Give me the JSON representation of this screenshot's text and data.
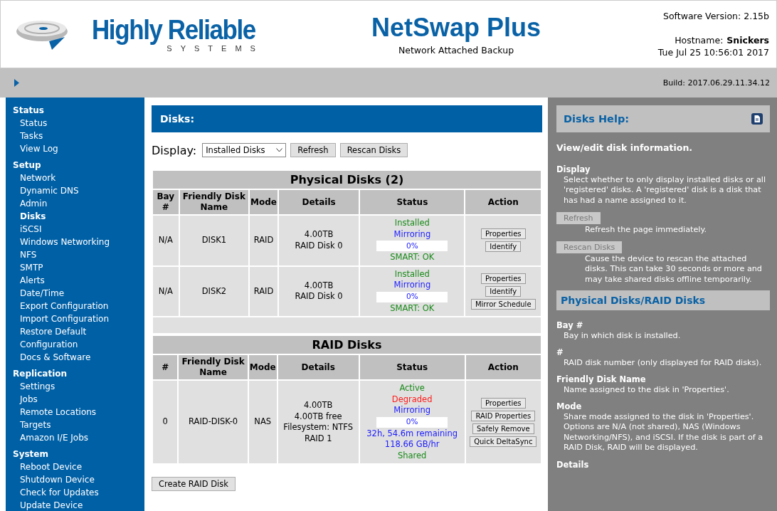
{
  "header": {
    "logo": {
      "name": "Highly Reliable",
      "tagline": "SYSTEMS"
    },
    "title": "NetSwap Plus",
    "subtitle": "Network Attached Backup",
    "software_version": "Software Version: 2.15b",
    "hostname_label": "Hostname:",
    "hostname": "Snickers",
    "datetime": "Tue Jul 25 10:56:01 2017"
  },
  "toolbar": {
    "build": "Build: 2017.06.29.11.34.12"
  },
  "sidebar": {
    "sections": [
      {
        "title": "Status",
        "items": [
          {
            "label": "Status",
            "selected": false
          },
          {
            "label": "Tasks",
            "selected": false
          },
          {
            "label": "View Log",
            "selected": false
          }
        ]
      },
      {
        "title": "Setup",
        "items": [
          {
            "label": "Network",
            "selected": false
          },
          {
            "label": "Dynamic DNS",
            "selected": false
          },
          {
            "label": "Admin",
            "selected": false
          },
          {
            "label": "Disks",
            "selected": true
          },
          {
            "label": "iSCSI",
            "selected": false
          },
          {
            "label": "Windows Networking",
            "selected": false
          },
          {
            "label": "NFS",
            "selected": false
          },
          {
            "label": "SMTP",
            "selected": false
          },
          {
            "label": "Alerts",
            "selected": false
          },
          {
            "label": "Date/Time",
            "selected": false
          },
          {
            "label": "Export Configuration",
            "selected": false
          },
          {
            "label": "Import Configuration",
            "selected": false
          },
          {
            "label": "Restore Default Configuration",
            "selected": false
          },
          {
            "label": "Docs & Software",
            "selected": false
          }
        ]
      },
      {
        "title": "Replication",
        "items": [
          {
            "label": "Settings",
            "selected": false
          },
          {
            "label": "Jobs",
            "selected": false
          },
          {
            "label": "Remote Locations",
            "selected": false
          },
          {
            "label": "Targets",
            "selected": false
          },
          {
            "label": "Amazon I/E Jobs",
            "selected": false
          }
        ]
      },
      {
        "title": "System",
        "items": [
          {
            "label": "Reboot Device",
            "selected": false
          },
          {
            "label": "Shutdown Device",
            "selected": false
          },
          {
            "label": "Check for Updates",
            "selected": false
          },
          {
            "label": "Update Device",
            "selected": false
          }
        ]
      }
    ]
  },
  "main": {
    "title": "Disks:",
    "display_label": "Display:",
    "display_select": "Installed Disks",
    "buttons": [
      "Refresh",
      "Rescan Disks"
    ],
    "tables": [
      {
        "title": "Physical Disks (2)",
        "columns": [
          "Bay #",
          "Friendly Disk Name",
          "Mode",
          "Details",
          "Status",
          "Action"
        ],
        "rows": [
          {
            "id": "N/A",
            "name": "DISK1",
            "mode": "RAID",
            "details": [
              "4.00TB",
              "RAID Disk 0"
            ],
            "status": [
              {
                "kind": "text",
                "text": "Installed",
                "color": "#1a8a1a"
              },
              {
                "kind": "text",
                "text": "Mirroring",
                "color": "#1a1aff"
              },
              {
                "kind": "progress",
                "level": 0,
                "reading": "0%"
              },
              {
                "kind": "text",
                "text": "SMART: OK",
                "color": "#1a8a1a"
              }
            ],
            "actions": [
              "Properties",
              "Identify"
            ]
          },
          {
            "id": "N/A",
            "name": "DISK2",
            "mode": "RAID",
            "details": [
              "4.00TB",
              "RAID Disk 0"
            ],
            "status": [
              {
                "kind": "text",
                "text": "Installed",
                "color": "#1a8a1a"
              },
              {
                "kind": "text",
                "text": "Mirroring",
                "color": "#1a1aff"
              },
              {
                "kind": "progress",
                "level": 0,
                "reading": "0%"
              },
              {
                "kind": "text",
                "text": "SMART: OK",
                "color": "#1a8a1a"
              }
            ],
            "actions": [
              "Properties",
              "Identify",
              "Mirror Schedule"
            ]
          }
        ]
      },
      {
        "title": "RAID Disks",
        "columns": [
          "#",
          "Friendly Disk Name",
          "Mode",
          "Details",
          "Status",
          "Action"
        ],
        "rows": [
          {
            "id": "0",
            "name": "RAID-DISK-0",
            "mode": "NAS",
            "details": [
              "4.00TB",
              "4.00TB free",
              "Filesystem: NTFS",
              "RAID 1"
            ],
            "status": [
              {
                "kind": "text",
                "text": "Active",
                "color": "#1a8a1a"
              },
              {
                "kind": "text",
                "text": "Degraded",
                "color": "#ff1a1a"
              },
              {
                "kind": "text",
                "text": "Mirroring",
                "color": "#1a1aff"
              },
              {
                "kind": "progress",
                "level": 0,
                "reading": "0%"
              },
              {
                "kind": "text",
                "text": "32h, 54.6m remaining",
                "color": "#1a1aff"
              },
              {
                "kind": "text",
                "text": "118.66 GB/hr",
                "color": "#1a1aff"
              },
              {
                "kind": "text",
                "text": "Shared",
                "color": "#1a8a1a"
              }
            ],
            "actions": [
              "Properties",
              "RAID Properties",
              "Safely Remove",
              "Quick DeltaSync"
            ]
          }
        ]
      }
    ],
    "create_button": "Create RAID Disk"
  },
  "help": {
    "title": "Disks Help:",
    "intro": "View/edit disk information.",
    "items": [
      {
        "kind": "topic",
        "term": "Display",
        "text": "Select whether to only display installed disks or all 'registered' disks. A 'registered' disk is a disk that has had a name assigned to it."
      },
      {
        "kind": "button",
        "term": "Refresh",
        "text": "Refresh the page immediately."
      },
      {
        "kind": "button",
        "term": "Rescan Disks",
        "text": "Cause the device to rescan the attached disks. This can take 30 seconds or more and may take shared disks offline temporarily."
      },
      {
        "kind": "heading",
        "term": "Physical Disks/RAID Disks"
      },
      {
        "kind": "topic",
        "term": "Bay #",
        "text": "Bay in which disk is installed."
      },
      {
        "kind": "topic",
        "term": "#",
        "text": "RAID disk number (only displayed for RAID disks)."
      },
      {
        "kind": "topic",
        "term": "Friendly Disk Name",
        "text": "Name assigned to the disk in 'Properties'."
      },
      {
        "kind": "topic",
        "term": "Mode",
        "text": "Share mode assigned to the disk in 'Properties'. Options are N/A (not shared), NAS (Windows Networking/NFS), and iSCSI. If the disk is part of a RAID Disk, RAID will be displayed."
      },
      {
        "kind": "topic",
        "term": "Details"
      }
    ]
  }
}
